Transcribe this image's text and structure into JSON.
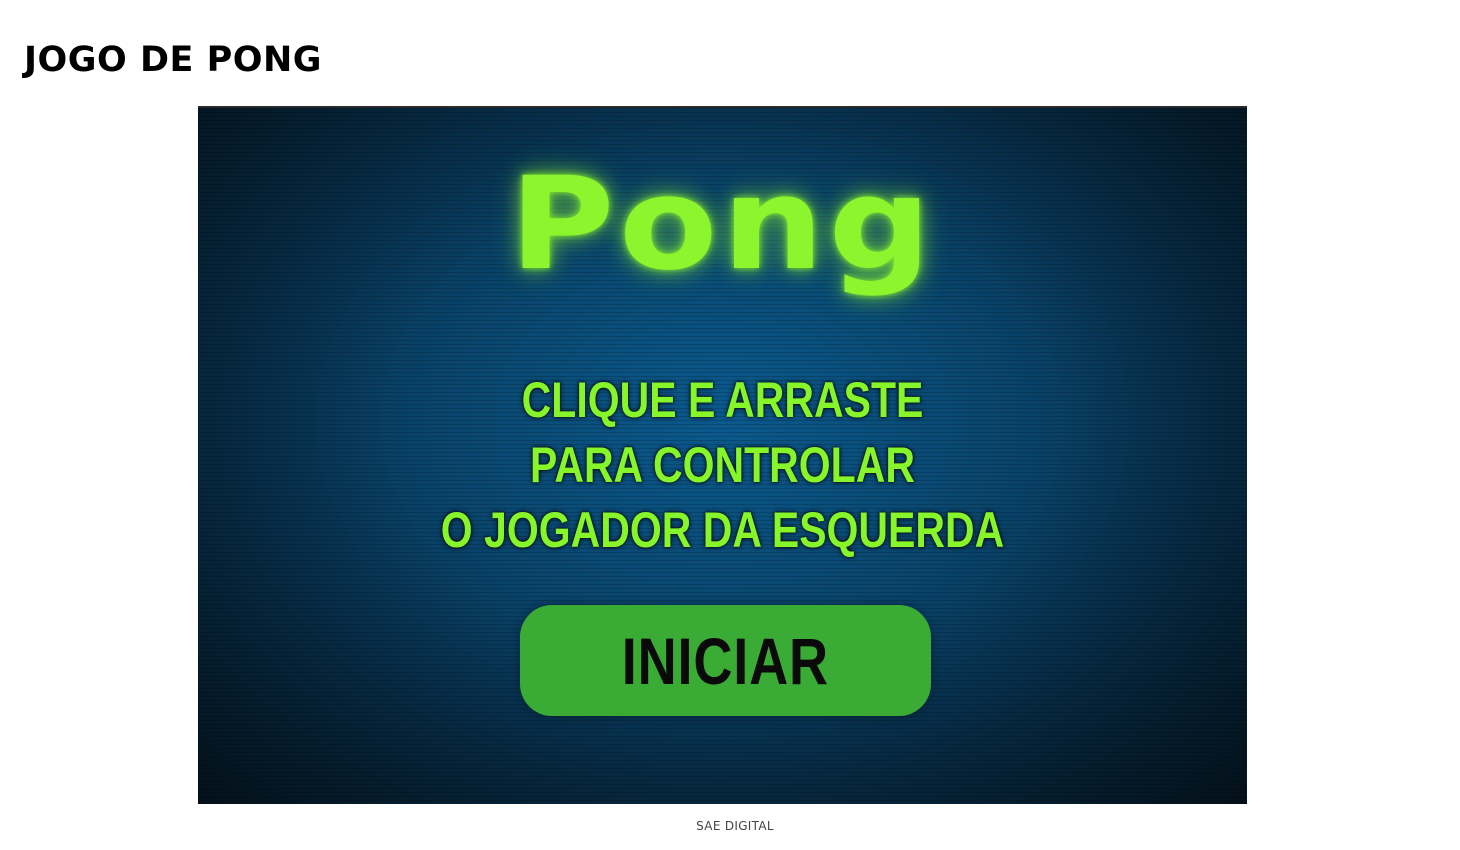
{
  "page": {
    "title": "JOGO DE PONG",
    "credit": "SAE DIGITAL"
  },
  "game": {
    "logo": "Pong",
    "instructions": [
      "CLIQUE E ARRASTE",
      "PARA CONTROLAR",
      "O JOGADOR DA ESQUERDA"
    ],
    "start_label": "INICIAR"
  },
  "colors": {
    "neon_green": "#8cf52e",
    "button_green": "#3aac35",
    "background_blue": "#0a4a74"
  }
}
